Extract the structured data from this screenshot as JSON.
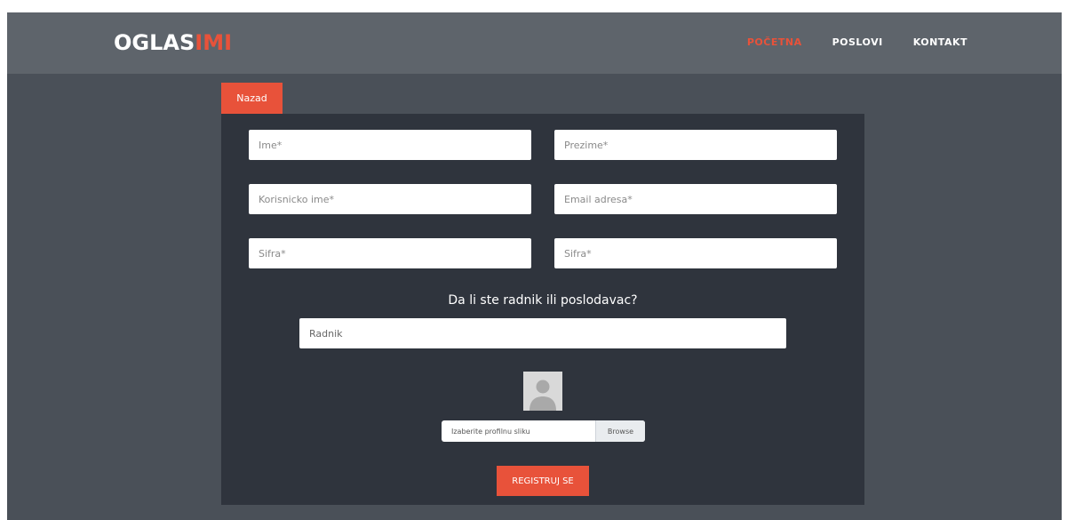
{
  "brand": {
    "logo_main": "OGLAS",
    "logo_accent": "IMI"
  },
  "nav": {
    "items": [
      {
        "label": "POČETNA",
        "active": true
      },
      {
        "label": "POSLOVI",
        "active": false
      },
      {
        "label": "KONTAKT",
        "active": false
      }
    ]
  },
  "back_label": "Nazad",
  "form": {
    "first_name_placeholder": "Ime*",
    "last_name_placeholder": "Prezime*",
    "username_placeholder": "Korisnicko ime*",
    "email_placeholder": "Email adresa*",
    "password_placeholder": "Sifra*",
    "password_confirm_placeholder": "Sifra*",
    "role_question": "Da li ste radnik ili poslodavac?",
    "role_selected": "Radnik",
    "profile_image_label": "Izaberite profilnu sliku",
    "browse_label": "Browse",
    "submit_label": "REGISTRUJ SE"
  },
  "colors": {
    "accent": "#e8523a",
    "panel": "#2f343d",
    "navbar": "#5e646b",
    "background": "#4a5058"
  }
}
